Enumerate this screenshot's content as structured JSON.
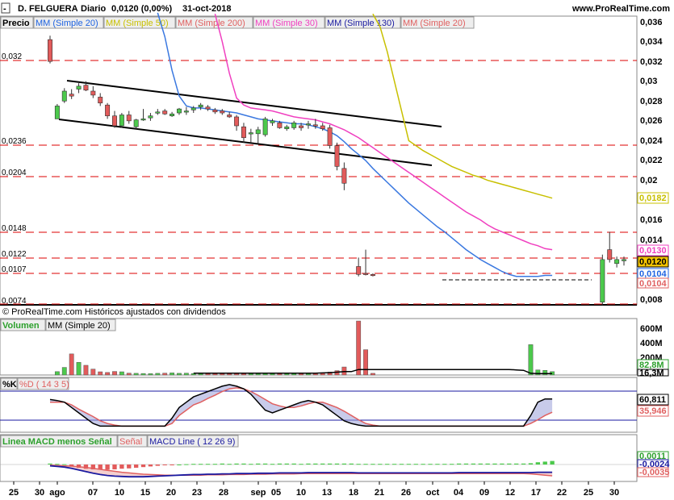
{
  "header": {
    "instrument": "D. FELGUERA",
    "period": "Diario",
    "quote": "0,0120 (0,00%)",
    "date": "31-oct-2018",
    "site": "www.ProRealTime.com"
  },
  "price_panel": {
    "label": "Precio",
    "footer": "© ProRealTime.com  Históricos ajustados con dividendos",
    "legend": [
      {
        "text": "MM (Simple 20)",
        "color": "#1f63e0"
      },
      {
        "text": "MM (Simple 50)",
        "color": "#c8c000"
      },
      {
        "text": "MM (Simple 200)",
        "color": "#e06060"
      },
      {
        "text": "MM (Simple 30)",
        "color": "#f040c0"
      },
      {
        "text": "MM (Simple 130)",
        "color": "#1a1aa0"
      },
      {
        "text": "MM (Simple 20)",
        "color": "#e06060"
      }
    ],
    "y_ticks": [
      "0,036",
      "0,034",
      "0,032",
      "0,03",
      "0,028",
      "0,026",
      "0,024",
      "0,022",
      "0,02",
      "0,016",
      "0,014",
      "0,008"
    ],
    "hlines": [
      "0,032",
      "0,0236",
      "0,0204",
      "0,0148",
      "0,0122",
      "0,0107",
      "0,0074"
    ],
    "value_tags": [
      {
        "text": "0,0182",
        "color": "#c8c000"
      },
      {
        "text": "0,0130",
        "color": "#f040c0"
      },
      {
        "text": "0,0120",
        "color": "#000000"
      },
      {
        "text": "0,0104",
        "color": "#1f63e0"
      },
      {
        "text": "0,0104",
        "color": "#e06060"
      }
    ]
  },
  "volume_panel": {
    "label": "Volumen",
    "legend": "MM (Simple 20)",
    "y_ticks": [
      "600M",
      "400M",
      "200M"
    ],
    "value_tags": [
      {
        "text": "82,8M",
        "color": "#2ca02c"
      },
      {
        "text": "16,3M",
        "color": "#000000"
      }
    ]
  },
  "stoch_panel": {
    "label_k": "%K",
    "label_d": "%D ( 14 3 5)",
    "value_tags": [
      {
        "text": "60,811",
        "color": "#000000"
      },
      {
        "text": "35,946",
        "color": "#e06060"
      }
    ]
  },
  "macd_panel": {
    "label_hist": "Linea MACD menos Señal",
    "label_signal": "Señal",
    "label_macd": "MACD Line ( 12 26 9)",
    "value_tags": [
      {
        "text": "0,0011",
        "color": "#2ca02c"
      },
      {
        "text": "-0,0024",
        "color": "#1a1aa0"
      },
      {
        "text": "-0,0035",
        "color": "#e06060"
      }
    ]
  },
  "x_labels": [
    "25",
    "30",
    "ago",
    "07",
    "10",
    "15",
    "20",
    "23",
    "28",
    "sep",
    "05",
    "10",
    "13",
    "18",
    "21",
    "26",
    "oct",
    "04",
    "09",
    "12",
    "17",
    "22",
    "25",
    "30"
  ],
  "chart_data": {
    "type": "candlestick",
    "title": "D. FELGUERA Diario",
    "y_unit": "EUR",
    "ylim": [
      0.0074,
      0.037
    ],
    "candles": [
      [
        0.0342,
        0.0346,
        0.0318,
        0.032
      ],
      [
        0.0262,
        0.0277,
        0.0262,
        0.0275
      ],
      [
        0.028,
        0.0293,
        0.0278,
        0.029
      ],
      [
        0.0287,
        0.0292,
        0.0282,
        0.0285
      ],
      [
        0.0292,
        0.0298,
        0.0288,
        0.0295
      ],
      [
        0.0296,
        0.03,
        0.029,
        0.0291
      ],
      [
        0.029,
        0.0295,
        0.0283,
        0.0286
      ],
      [
        0.0284,
        0.0288,
        0.0275,
        0.0278
      ],
      [
        0.0276,
        0.0278,
        0.0262,
        0.0265
      ],
      [
        0.0265,
        0.027,
        0.0253,
        0.0255
      ],
      [
        0.0255,
        0.0268,
        0.0253,
        0.0266
      ],
      [
        0.0266,
        0.027,
        0.0257,
        0.026
      ],
      [
        0.0254,
        0.0262,
        0.0252,
        0.0261
      ],
      [
        0.0262,
        0.0272,
        0.026,
        0.0262
      ],
      [
        0.0263,
        0.0268,
        0.026,
        0.0265
      ],
      [
        0.0268,
        0.0272,
        0.0266,
        0.0269
      ],
      [
        0.027,
        0.0272,
        0.0266,
        0.0267
      ],
      [
        0.0265,
        0.0269,
        0.0264,
        0.0267
      ],
      [
        0.0268,
        0.0273,
        0.0266,
        0.0272
      ],
      [
        0.027,
        0.0274,
        0.0266,
        0.027
      ],
      [
        0.0271,
        0.0275,
        0.0268,
        0.0273
      ],
      [
        0.0274,
        0.0278,
        0.0271,
        0.0276
      ],
      [
        0.0274,
        0.0276,
        0.027,
        0.0272
      ],
      [
        0.0271,
        0.0273,
        0.0267,
        0.0269
      ],
      [
        0.027,
        0.0272,
        0.0266,
        0.0268
      ],
      [
        0.0266,
        0.0269,
        0.0263,
        0.0264
      ],
      [
        0.0264,
        0.0266,
        0.025,
        0.0255
      ],
      [
        0.0254,
        0.0258,
        0.0238,
        0.0243
      ],
      [
        0.0247,
        0.0252,
        0.0238,
        0.0248
      ],
      [
        0.0247,
        0.0254,
        0.0237,
        0.0251
      ],
      [
        0.0246,
        0.0264,
        0.0244,
        0.0262
      ],
      [
        0.0258,
        0.0262,
        0.0255,
        0.026
      ],
      [
        0.0258,
        0.026,
        0.0252,
        0.0253
      ],
      [
        0.0252,
        0.0256,
        0.025,
        0.0254
      ],
      [
        0.0253,
        0.026,
        0.0251,
        0.0258
      ],
      [
        0.0255,
        0.0258,
        0.025,
        0.0253
      ],
      [
        0.0257,
        0.026,
        0.0252,
        0.0257
      ],
      [
        0.0256,
        0.0262,
        0.0252,
        0.0255
      ],
      [
        0.0255,
        0.0258,
        0.025,
        0.0252
      ],
      [
        0.0253,
        0.0256,
        0.0232,
        0.0235
      ],
      [
        0.0235,
        0.0238,
        0.021,
        0.0214
      ],
      [
        0.0212,
        0.0218,
        0.019,
        0.0197
      ],
      null,
      [
        0.0113,
        0.0122,
        0.0103,
        0.0105
      ],
      [
        0.0106,
        0.013,
        0.0104,
        0.0105
      ],
      [
        0.0105,
        0.0106,
        0.0103,
        0.0104
      ],
      null,
      null,
      null,
      null,
      null,
      null,
      null,
      null,
      null,
      null,
      null,
      null,
      null,
      null,
      null,
      null,
      null,
      null,
      null,
      null,
      null,
      null,
      null,
      null,
      null,
      null,
      null,
      null,
      null,
      null,
      null,
      [
        0.0077,
        0.0125,
        0.0074,
        0.012
      ],
      [
        0.013,
        0.0148,
        0.0117,
        0.012
      ],
      [
        0.0116,
        0.0123,
        0.0112,
        0.012
      ],
      [
        0.012,
        0.0123,
        0.0114,
        0.012
      ]
    ],
    "sma20": [
      null,
      null,
      null,
      null,
      null,
      null,
      null,
      null,
      null,
      null,
      null,
      null,
      null,
      null,
      null,
      0.0369,
      0.0345,
      0.0311,
      0.0285,
      0.0275,
      0.0273,
      0.0273,
      0.0272,
      0.0271,
      0.027,
      0.0269,
      0.0268,
      0.0266,
      0.0264,
      0.0262,
      0.0261,
      0.026,
      0.0259,
      0.0258,
      0.0257,
      0.0257,
      0.0256,
      0.0254,
      0.0252,
      0.0249,
      0.0245,
      0.0239,
      0.0232,
      0.0226,
      0.022,
      0.0212,
      0.0205,
      0.0198,
      0.0191,
      0.0184,
      0.0177,
      0.0171,
      0.0165,
      0.0159,
      0.0153,
      0.0148,
      0.0142,
      0.0136,
      0.013,
      0.0125,
      0.012,
      0.0116,
      0.0112,
      0.0108,
      0.0105,
      0.0103,
      0.0103,
      0.0103,
      0.0103,
      0.0104,
      0.0104
    ],
    "sma30": [
      null,
      null,
      null,
      null,
      null,
      null,
      null,
      null,
      null,
      null,
      null,
      null,
      null,
      null,
      null,
      null,
      null,
      null,
      null,
      null,
      null,
      null,
      null,
      0.0368,
      0.034,
      0.0308,
      0.0283,
      0.0276,
      0.0273,
      0.0272,
      0.0271,
      0.027,
      0.0268,
      0.0266,
      0.0264,
      0.0263,
      0.0262,
      0.0261,
      0.0259,
      0.0257,
      0.0254,
      0.0251,
      0.0247,
      0.0243,
      0.0238,
      0.0233,
      0.0228,
      0.0223,
      0.0218,
      0.0213,
      0.0208,
      0.0203,
      0.0198,
      0.0193,
      0.0188,
      0.0183,
      0.0178,
      0.0173,
      0.0168,
      0.0164,
      0.016,
      0.0155,
      0.0151,
      0.0148,
      0.0145,
      0.0142,
      0.0139,
      0.0136,
      0.0134,
      0.0131,
      0.013
    ],
    "sma50": [
      null,
      null,
      null,
      null,
      null,
      null,
      null,
      null,
      null,
      null,
      null,
      null,
      null,
      null,
      null,
      null,
      null,
      null,
      null,
      null,
      null,
      null,
      null,
      null,
      null,
      null,
      null,
      null,
      null,
      null,
      null,
      null,
      null,
      null,
      null,
      null,
      null,
      null,
      null,
      null,
      null,
      null,
      null,
      null,
      null,
      0.0368,
      0.0355,
      0.033,
      0.03,
      0.027,
      0.024,
      0.0235,
      0.023,
      0.0226,
      0.0222,
      0.0218,
      0.0214,
      0.0211,
      0.0208,
      0.0205,
      0.0203,
      0.02,
      0.0198,
      0.0196,
      0.0194,
      0.0192,
      0.019,
      0.0188,
      0.0186,
      0.0184,
      0.0182
    ],
    "volume": [
      0,
      40,
      90,
      250,
      150,
      115,
      70,
      38,
      30,
      42,
      38,
      22,
      20,
      18,
      16,
      20,
      22,
      25,
      20,
      22,
      18,
      22,
      20,
      22,
      18,
      20,
      18,
      22,
      20,
      18,
      20,
      18,
      18,
      20,
      18,
      20,
      18,
      22,
      25,
      35,
      52,
      95,
      0,
      640,
      300,
      20,
      0,
      0,
      0,
      0,
      0,
      0,
      0,
      0,
      0,
      0,
      0,
      0,
      0,
      0,
      0,
      0,
      0,
      0,
      0,
      0,
      0,
      360,
      60,
      55,
      40
    ],
    "volume_sma20": [
      null,
      null,
      null,
      null,
      null,
      null,
      null,
      null,
      null,
      null,
      null,
      null,
      null,
      null,
      null,
      null,
      null,
      null,
      null,
      null,
      22,
      22,
      22,
      22,
      22,
      22,
      22,
      22,
      22,
      22,
      22,
      22,
      22,
      22,
      22,
      22,
      22,
      22,
      25,
      28,
      33,
      40,
      40,
      65,
      65,
      65,
      65,
      65,
      65,
      65,
      65,
      65,
      65,
      65,
      65,
      65,
      65,
      65,
      65,
      65,
      65,
      65,
      65,
      65,
      65,
      60,
      55,
      20,
      16,
      16,
      16
    ],
    "stoch_k": [
      60,
      58,
      55,
      45,
      35,
      25,
      15,
      10,
      10,
      10,
      10,
      10,
      10,
      10,
      10,
      10,
      10,
      25,
      45,
      55,
      65,
      70,
      75,
      80,
      85,
      88,
      85,
      80,
      70,
      55,
      40,
      35,
      40,
      45,
      50,
      55,
      58,
      55,
      50,
      40,
      30,
      20,
      15,
      12,
      10,
      10,
      10,
      10,
      10,
      10,
      10,
      10,
      10,
      10,
      10,
      10,
      10,
      10,
      10,
      10,
      10,
      10,
      10,
      10,
      10,
      10,
      10,
      30,
      55,
      61,
      61
    ],
    "stoch_d": [
      55,
      55,
      55,
      50,
      42,
      35,
      28,
      20,
      15,
      12,
      10,
      10,
      10,
      10,
      10,
      10,
      10,
      15,
      30,
      40,
      50,
      55,
      62,
      68,
      75,
      80,
      82,
      80,
      75,
      68,
      60,
      52,
      48,
      45,
      45,
      48,
      52,
      55,
      55,
      50,
      45,
      38,
      30,
      22,
      15,
      12,
      10,
      10,
      10,
      10,
      10,
      10,
      10,
      10,
      10,
      10,
      10,
      10,
      10,
      10,
      10,
      10,
      10,
      10,
      10,
      10,
      10,
      15,
      22,
      30,
      36
    ],
    "macd": [
      -0.0004,
      -0.0006,
      -0.0008,
      -0.0012,
      -0.0017,
      -0.0022,
      -0.0027,
      -0.0031,
      -0.0034,
      -0.0036,
      -0.0037,
      -0.0038,
      -0.0038,
      -0.0038,
      -0.0037,
      -0.0036,
      -0.0035,
      -0.0034,
      -0.0033,
      -0.0032,
      -0.0031,
      -0.0031,
      -0.003,
      -0.003,
      -0.0029,
      -0.0029,
      -0.0028,
      -0.0028,
      -0.0028,
      -0.0027,
      -0.0027,
      -0.0027,
      -0.0026,
      -0.0026,
      -0.0026,
      -0.0026,
      -0.0025,
      -0.0025,
      -0.0025,
      -0.0025,
      -0.0025,
      -0.0025,
      -0.0025,
      -0.0026,
      -0.0026,
      -0.0026,
      -0.0026,
      -0.0026,
      -0.0026,
      -0.0026,
      -0.0026,
      -0.0026,
      -0.0026,
      -0.0026,
      -0.0026,
      -0.0026,
      -0.0026,
      -0.0025,
      -0.0025,
      -0.0025,
      -0.0025,
      -0.0025,
      -0.0025,
      -0.0025,
      -0.0025,
      -0.0025,
      -0.0025,
      -0.0025,
      -0.0024,
      -0.0024,
      -0.0024
    ],
    "signal": [
      -0.0002,
      -0.0003,
      -0.0004,
      -0.0005,
      -0.0007,
      -0.0009,
      -0.0012,
      -0.0015,
      -0.0018,
      -0.0021,
      -0.0024,
      -0.0026,
      -0.0028,
      -0.003,
      -0.0031,
      -0.0032,
      -0.0033,
      -0.0033,
      -0.0033,
      -0.0033,
      -0.0033,
      -0.0033,
      -0.0032,
      -0.0032,
      -0.0032,
      -0.0031,
      -0.0031,
      -0.0031,
      -0.003,
      -0.003,
      -0.003,
      -0.0029,
      -0.0029,
      -0.0029,
      -0.0029,
      -0.0028,
      -0.0028,
      -0.0028,
      -0.0028,
      -0.0028,
      -0.0028,
      -0.0028,
      -0.0028,
      -0.0028,
      -0.0028,
      -0.0028,
      -0.0028,
      -0.0028,
      -0.0028,
      -0.0028,
      -0.0028,
      -0.0028,
      -0.0028,
      -0.0028,
      -0.0028,
      -0.0028,
      -0.0028,
      -0.0028,
      -0.0028,
      -0.0028,
      -0.0028,
      -0.0028,
      -0.0028,
      -0.0028,
      -0.0028,
      -0.0028,
      -0.0028,
      -0.0029,
      -0.0031,
      -0.0033,
      -0.0035
    ],
    "macd_hist": [
      0.0003,
      0.0002,
      0.0001,
      -0.0005,
      -0.001,
      -0.0013,
      -0.0015,
      -0.0016,
      -0.0016,
      -0.0015,
      -0.0013,
      -0.0012,
      -0.001,
      -0.0008,
      -0.0006,
      -0.0004,
      -0.0002,
      -0.0001,
      0.0,
      0.0001,
      0.0002,
      0.0002,
      0.0002,
      0.0002,
      0.0003,
      0.0002,
      0.0003,
      0.0003,
      0.0002,
      0.0003,
      0.0003,
      0.0002,
      0.0003,
      0.0003,
      0.0003,
      0.0002,
      0.0003,
      0.0003,
      0.0003,
      0.0003,
      0.0003,
      0.0003,
      0.0003,
      0.0002,
      0.0002,
      0.0002,
      0.0002,
      0.0002,
      0.0002,
      0.0002,
      0.0002,
      0.0002,
      0.0002,
      0.0002,
      0.0002,
      0.0002,
      0.0002,
      0.0003,
      0.0003,
      0.0003,
      0.0003,
      0.0003,
      0.0003,
      0.0003,
      0.0003,
      0.0003,
      0.0003,
      0.0004,
      0.0007,
      0.0009,
      0.0011
    ]
  }
}
